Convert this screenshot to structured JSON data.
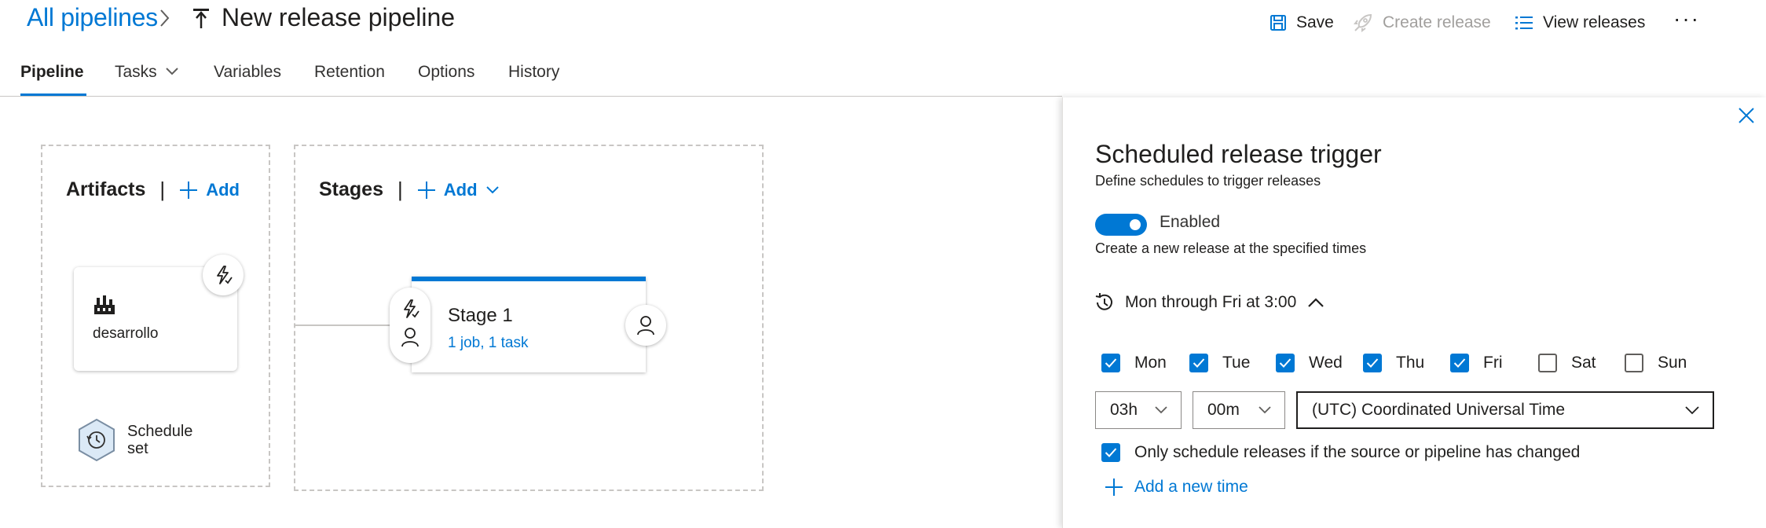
{
  "header": {
    "breadcrumb": "All pipelines",
    "title": "New release pipeline",
    "actions": {
      "save": "Save",
      "create_release": "Create release",
      "view_releases": "View releases",
      "more": "···"
    }
  },
  "tabs": [
    {
      "label": "Pipeline",
      "active": true
    },
    {
      "label": "Tasks",
      "has_dropdown": true
    },
    {
      "label": "Variables"
    },
    {
      "label": "Retention"
    },
    {
      "label": "Options"
    },
    {
      "label": "History"
    }
  ],
  "artifacts": {
    "title": "Artifacts",
    "separator": "|",
    "add_label": "Add",
    "items": [
      {
        "name": "desarrollo"
      }
    ],
    "schedule_badge": {
      "line1": "Schedule",
      "line2": "set"
    }
  },
  "stages": {
    "title": "Stages",
    "separator": "|",
    "add_label": "Add",
    "items": [
      {
        "name": "Stage 1",
        "summary": "1 job, 1 task"
      }
    ]
  },
  "panel": {
    "title": "Scheduled release trigger",
    "subtitle": "Define schedules to trigger releases",
    "toggle": {
      "label": "Enabled",
      "on": true
    },
    "description": "Create a new release at the specified times",
    "schedule_summary": "Mon through Fri at 3:00",
    "days": [
      {
        "label": "Mon",
        "checked": true
      },
      {
        "label": "Tue",
        "checked": true
      },
      {
        "label": "Wed",
        "checked": true
      },
      {
        "label": "Thu",
        "checked": true
      },
      {
        "label": "Fri",
        "checked": true
      },
      {
        "label": "Sat",
        "checked": false
      },
      {
        "label": "Sun",
        "checked": false
      }
    ],
    "hour": "03h",
    "minute": "00m",
    "timezone": "(UTC) Coordinated Universal Time",
    "only_changed": {
      "label": "Only schedule releases if the source or pipeline has changed",
      "checked": true
    },
    "add_time": "Add a new time"
  },
  "colors": {
    "accent": "#0078d4",
    "text": "#201f1e",
    "disabled": "#a19f9d",
    "border": "#c8c6c4"
  }
}
